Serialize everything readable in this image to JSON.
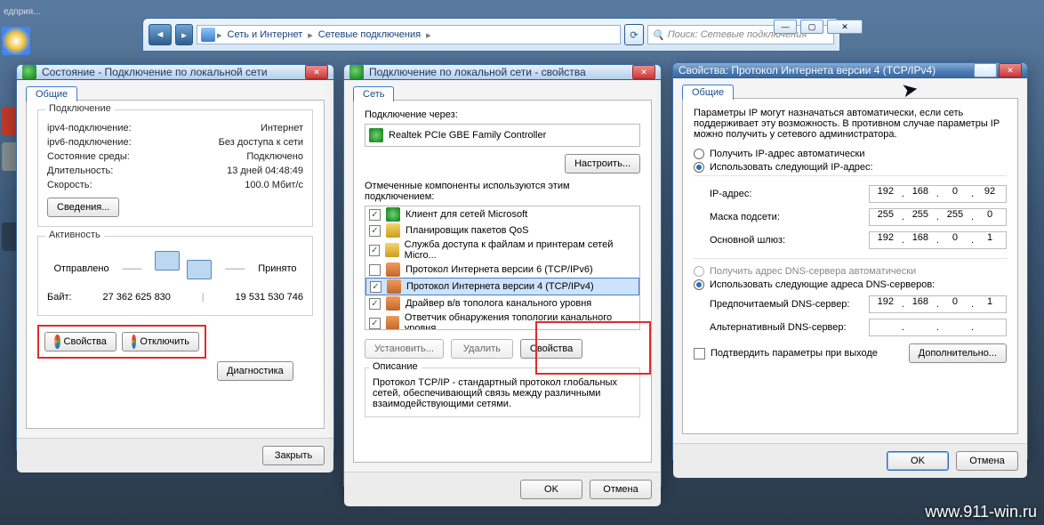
{
  "misc": {
    "taskbar_label": "едприя...",
    "watermark": "www.911-win.ru"
  },
  "explorer": {
    "crumb1": "Сеть и Интернет",
    "crumb2": "Сетевые подключения",
    "search_placeholder": "Поиск: Сетевые подключения",
    "min": "—",
    "max": "▢",
    "close": "✕"
  },
  "status": {
    "title": "Состояние - Подключение по локальной сети",
    "tab_general": "Общие",
    "group_conn": "Подключение",
    "rows": {
      "ipv4_label": "ipv4-подключение:",
      "ipv4_value": "Интернет",
      "ipv6_label": "ipv6-подключение:",
      "ipv6_value": "Без доступа к сети",
      "env_label": "Состояние среды:",
      "env_value": "Подключено",
      "dur_label": "Длительность:",
      "dur_value": "13 дней 04:48:49",
      "spd_label": "Скорость:",
      "spd_value": "100.0 Мбит/c"
    },
    "btn_details": "Сведения...",
    "group_activity": "Активность",
    "sent_label": "Отправлено",
    "recv_label": "Принято",
    "bytes_label": "Байт:",
    "bytes_sent": "27 362 625 830",
    "bytes_recv": "19 531 530 746",
    "btn_props": "Свойства",
    "btn_disable": "Отключить",
    "btn_diag": "Диагностика",
    "btn_close": "Закрыть"
  },
  "props": {
    "title": "Подключение по локальной сети - свойства",
    "tab_net": "Сеть",
    "conn_via_label": "Подключение через:",
    "adapter": "Realtek PCIe GBE Family Controller",
    "btn_configure": "Настроить...",
    "check_label": "Отмеченные компоненты используются этим подключением:",
    "items": [
      {
        "checked": true,
        "label": "Клиент для сетей Microsoft"
      },
      {
        "checked": true,
        "label": "Планировщик пакетов QoS"
      },
      {
        "checked": true,
        "label": "Служба доступа к файлам и принтерам сетей Micro..."
      },
      {
        "checked": false,
        "label": "Протокол Интернета версии 6 (TCP/IPv6)"
      },
      {
        "checked": true,
        "label": "Протокол Интернета версии 4 (TCP/IPv4)"
      },
      {
        "checked": true,
        "label": "Драйвер в/в тополога канального уровня"
      },
      {
        "checked": true,
        "label": "Ответчик обнаружения топологии канального уровня"
      }
    ],
    "btn_install": "Установить...",
    "btn_uninstall": "Удалить",
    "btn_itemprops": "Свойства",
    "desc_title": "Описание",
    "desc_body": "Протокол TCP/IP - стандартный протокол глобальных сетей, обеспечивающий связь между различными взаимодействующими сетями.",
    "btn_ok": "OK",
    "btn_cancel": "Отмена"
  },
  "ipv4": {
    "title": "Свойства: Протокол Интернета версии 4 (TCP/IPv4)",
    "tab_general": "Общие",
    "intro": "Параметры IP могут назначаться автоматически, если сеть поддерживает эту возможность. В противном случае параметры IP можно получить у сетевого администратора.",
    "r_auto_ip": "Получить IP-адрес автоматически",
    "r_manual_ip": "Использовать следующий IP-адрес:",
    "ip_label": "IP-адрес:",
    "ip": [
      "192",
      "168",
      "0",
      "92"
    ],
    "mask_label": "Маска подсети:",
    "mask": [
      "255",
      "255",
      "255",
      "0"
    ],
    "gw_label": "Основной шлюз:",
    "gw": [
      "192",
      "168",
      "0",
      "1"
    ],
    "r_auto_dns": "Получить адрес DNS-сервера автоматически",
    "r_manual_dns": "Использовать следующие адреса DNS-серверов:",
    "dns1_label": "Предпочитаемый DNS-сервер:",
    "dns1": [
      "192",
      "168",
      "0",
      "1"
    ],
    "dns2_label": "Альтернативный DNS-сервер:",
    "dns2": [
      "",
      "",
      "",
      ""
    ],
    "confirm_label": "Подтвердить параметры при выходе",
    "btn_advanced": "Дополнительно...",
    "btn_ok": "OK",
    "btn_cancel": "Отмена"
  }
}
